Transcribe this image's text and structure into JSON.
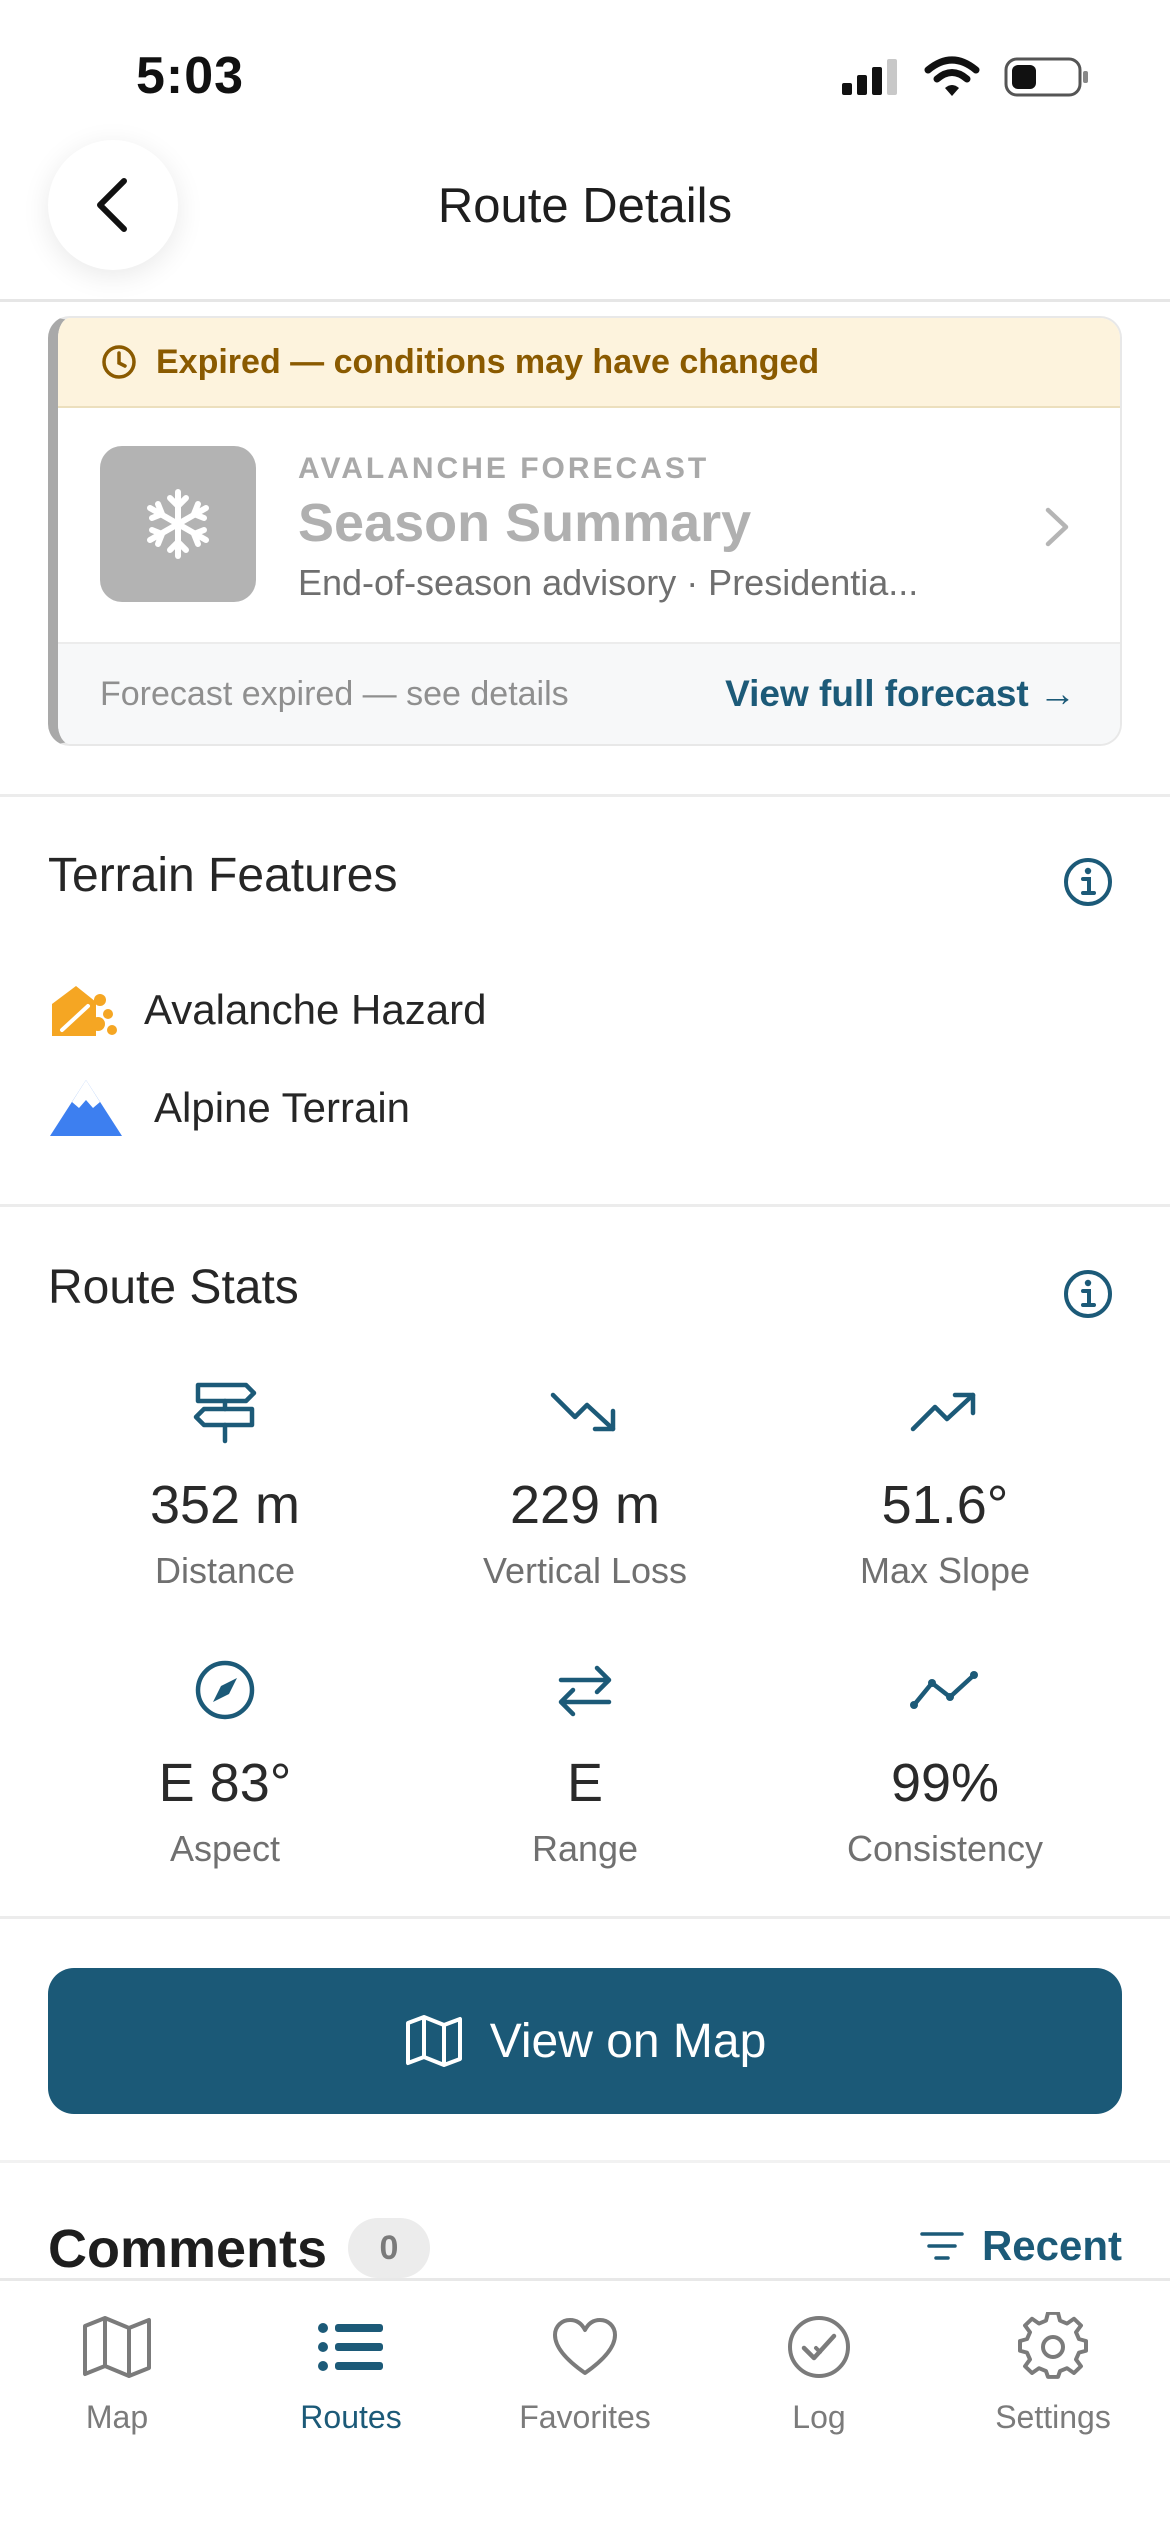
{
  "status_bar": {
    "time": "5:03"
  },
  "header": {
    "title": "Route Details"
  },
  "forecast": {
    "expired_notice": "Expired — conditions may have changed",
    "eyebrow": "AVALANCHE FORECAST",
    "title": "Season Summary",
    "subtitle": "End-of-season advisory · Presidentia...",
    "footer_note": "Forecast expired — see details",
    "view_link": "View full forecast →"
  },
  "terrain": {
    "title": "Terrain Features",
    "features": [
      {
        "label": "Avalanche Hazard",
        "icon": "avalanche-hazard-icon",
        "color": "#f5a623"
      },
      {
        "label": "Alpine Terrain",
        "icon": "mountain-icon",
        "color": "#3d7ff0"
      }
    ]
  },
  "stats": {
    "title": "Route Stats",
    "items": [
      {
        "value": "352 m",
        "label": "Distance",
        "icon": "signpost-icon"
      },
      {
        "value": "229 m",
        "label": "Vertical Loss",
        "icon": "trend-down-icon"
      },
      {
        "value": "51.6°",
        "label": "Max Slope",
        "icon": "trend-up-icon"
      },
      {
        "value": "E 83°",
        "label": "Aspect",
        "icon": "compass-icon"
      },
      {
        "value": "E",
        "label": "Range",
        "icon": "arrows-exchange-icon"
      },
      {
        "value": "99%",
        "label": "Consistency",
        "icon": "line-graph-icon"
      }
    ]
  },
  "map_button": {
    "label": "View on Map"
  },
  "comments": {
    "title": "Comments",
    "count": "0",
    "sort_label": "Recent"
  },
  "tabs": [
    {
      "label": "Map",
      "icon": "map-icon",
      "active": false
    },
    {
      "label": "Routes",
      "icon": "list-icon",
      "active": true
    },
    {
      "label": "Favorites",
      "icon": "heart-icon",
      "active": false
    },
    {
      "label": "Log",
      "icon": "check-circle-icon",
      "active": false
    },
    {
      "label": "Settings",
      "icon": "gear-icon",
      "active": false
    }
  ],
  "colors": {
    "accent": "#1b5977",
    "expired_bg": "#fdf3dd",
    "expired_text": "#8a5a00"
  }
}
